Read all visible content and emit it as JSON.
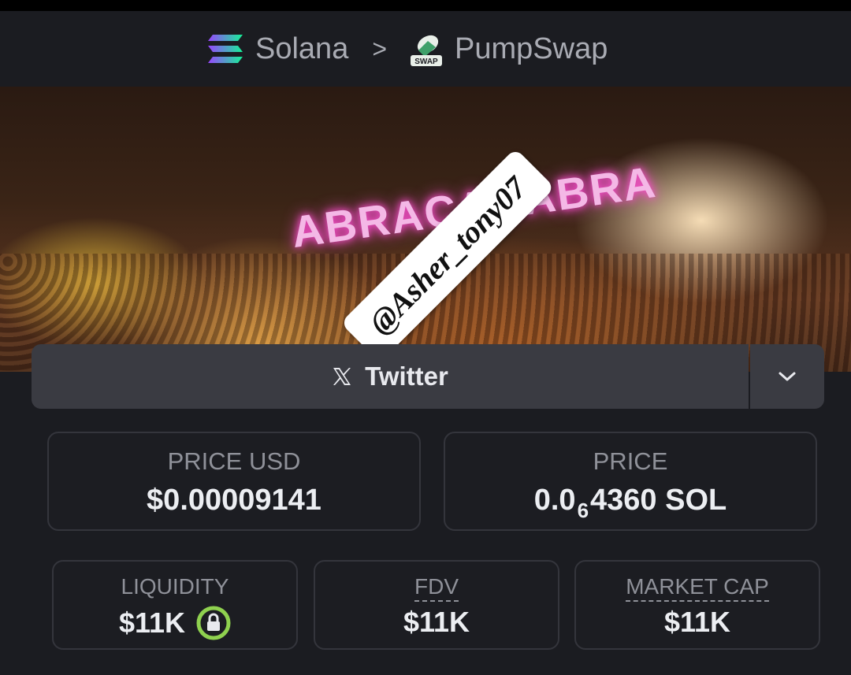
{
  "header": {
    "chain": "Solana",
    "separator": ">",
    "dex": "PumpSwap",
    "dex_badge": "SWAP"
  },
  "banner": {
    "sign_text": "ABRACADABRA",
    "watermark": "@Asher_tony07"
  },
  "social": {
    "twitter_label": "Twitter",
    "x_glyph": "𝕏",
    "dropdown_glyph": "chevron-down-icon"
  },
  "stats": {
    "price_usd": {
      "label": "PRICE USD",
      "value": "$0.00009141"
    },
    "price": {
      "label": "PRICE",
      "prefix": "0.0",
      "zeros": "6",
      "suffix": "4360 SOL"
    },
    "liquidity": {
      "label": "LIQUIDITY",
      "value": "$11K"
    },
    "fdv": {
      "label": "FDV",
      "value": "$11K"
    },
    "market_cap": {
      "label": "MARKET CAP",
      "value": "$11K"
    }
  },
  "colors": {
    "background": "#1b1c21",
    "card_border": "#34353c",
    "button_bg": "#3a3b42",
    "lock_green": "#8fd14f"
  }
}
